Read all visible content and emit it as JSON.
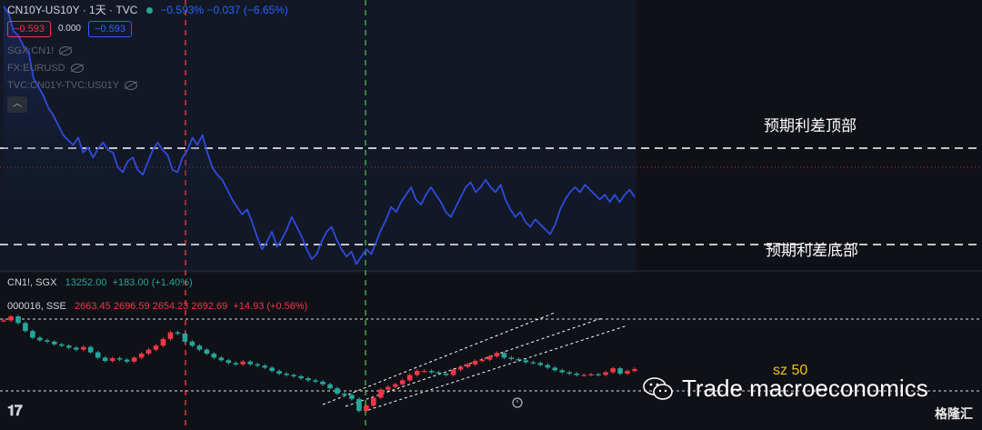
{
  "header": {
    "symbol": "CN10Y-US10Y · 1天 · TVC",
    "change": "−0.593%  −0.037 (−6.65%)",
    "value_red": "−0.593",
    "value_plain": "0.000",
    "value_blue": "−0.593"
  },
  "indicators": [
    "SGX:CN1!",
    "FX:EURUSD",
    "TVC:CN01Y-TVC:US01Y"
  ],
  "lower_legend": {
    "cn1": {
      "name": "CN1!, SGX",
      "value": "13252.00",
      "change": "+183.00 (+1.40%)"
    },
    "sse": {
      "name": "000016, SSE",
      "ohlc": "2663.45  2696.59  2654.23  2692.69",
      "change": "+14.93 (+0.56%)"
    }
  },
  "annotations": {
    "top_label": "预期利差顶部",
    "bottom_label": "预期利差底部",
    "sz_label": "sz 50"
  },
  "watermark": "Trade macroeconomics",
  "logo_text": "格隆汇",
  "colors": {
    "background": "#0f1117",
    "spread_line": "#2f4bdc",
    "up": "#26a69a",
    "down": "#f23645",
    "red_marker": "#f23645",
    "green_marker": "#4caf50"
  },
  "chart_data": [
    {
      "type": "line",
      "title": "CN10Y-US10Y",
      "series": [
        {
          "name": "CN10Y-US10Y",
          "values": [
            0.6,
            0.54,
            0.4,
            0.36,
            0.28,
            0.24,
            0.02,
            -0.05,
            -0.12,
            -0.22,
            -0.28,
            -0.36,
            -0.44,
            -0.48,
            -0.52,
            -0.46,
            -0.58,
            -0.54,
            -0.62,
            -0.55,
            -0.5,
            -0.56,
            -0.58,
            -0.7,
            -0.74,
            -0.65,
            -0.62,
            -0.72,
            -0.76,
            -0.66,
            -0.56,
            -0.5,
            -0.56,
            -0.6,
            -0.72,
            -0.74,
            -0.62,
            -0.56,
            -0.46,
            -0.52,
            -0.44,
            -0.58,
            -0.7,
            -0.76,
            -0.8,
            -0.88,
            -0.96,
            -1.02,
            -1.08,
            -1.04,
            -1.14,
            -1.26,
            -1.36,
            -1.3,
            -1.22,
            -1.34,
            -1.28,
            -1.2,
            -1.1,
            -1.18,
            -1.26,
            -1.36,
            -1.44,
            -1.4,
            -1.3,
            -1.22,
            -1.18,
            -1.28,
            -1.36,
            -1.42,
            -1.38,
            -1.48,
            -1.42,
            -1.36,
            -1.4,
            -1.3,
            -1.2,
            -1.12,
            -1.02,
            -1.06,
            -0.98,
            -0.92,
            -0.86,
            -0.96,
            -1.0,
            -0.92,
            -0.86,
            -0.92,
            -0.98,
            -1.06,
            -1.1,
            -1.02,
            -0.94,
            -0.86,
            -0.82,
            -0.9,
            -0.86,
            -0.8,
            -0.86,
            -0.9,
            -0.84,
            -0.96,
            -1.04,
            -1.1,
            -1.06,
            -1.14,
            -1.18,
            -1.12,
            -1.16,
            -1.2,
            -1.24,
            -1.16,
            -1.04,
            -0.96,
            -0.9,
            -0.86,
            -0.9,
            -0.84,
            -0.88,
            -0.92,
            -0.96,
            -0.92,
            -0.98,
            -0.92,
            -0.98,
            -0.92,
            -0.88,
            -0.94
          ]
        }
      ],
      "reference_levels": [
        -0.8,
        -1.44
      ],
      "ylim": [
        -1.55,
        0.65
      ]
    },
    {
      "type": "line",
      "title": "000016, SSE",
      "series": [
        {
          "name": "000016",
          "values": [
            3280,
            3310,
            3260,
            3200,
            3150,
            3130,
            3120,
            3100,
            3090,
            3075,
            3060,
            3080,
            3040,
            3000,
            2975,
            2995,
            2985,
            2970,
            3000,
            3030,
            3060,
            3090,
            3140,
            3190,
            3180,
            3120,
            3090,
            3060,
            3030,
            3000,
            2980,
            2960,
            2950,
            2970,
            2950,
            2940,
            2925,
            2900,
            2880,
            2870,
            2860,
            2845,
            2830,
            2820,
            2800,
            2770,
            2730,
            2720,
            2690,
            2600,
            2640,
            2700,
            2760,
            2780,
            2800,
            2830,
            2870,
            2900,
            2900,
            2890,
            2880,
            2870,
            2910,
            2930,
            2950,
            2975,
            2985,
            3010,
            3035,
            3000,
            2990,
            2980,
            2965,
            2960,
            2945,
            2925,
            2905,
            2890,
            2880,
            2870,
            2870,
            2875,
            2870,
            2890,
            2920,
            2880,
            2900,
            2915
          ]
        }
      ]
    }
  ]
}
